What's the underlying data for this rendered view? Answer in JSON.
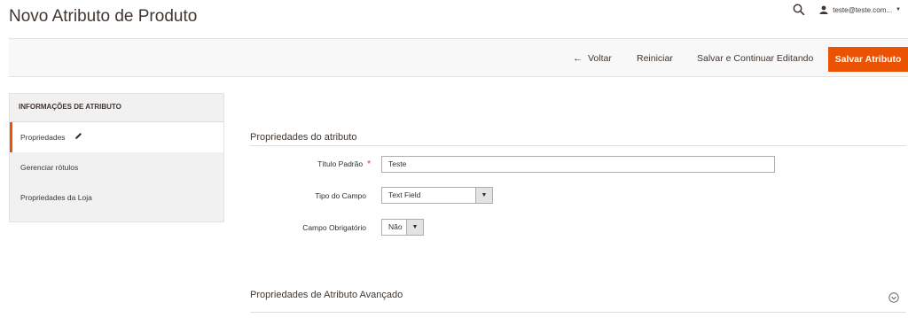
{
  "header": {
    "title": "Novo Atributo de Produto",
    "user": "teste@teste.com...",
    "search_icon": "search-icon",
    "user_icon": "user-icon"
  },
  "actions": {
    "back": "Voltar",
    "reset": "Reiniciar",
    "save_continue": "Salvar e Continuar Editando",
    "save": "Salvar Atributo",
    "accent": "#eb5202"
  },
  "sidebar": {
    "heading": "INFORMAÇÕES DE ATRIBUTO",
    "items": [
      {
        "label": "Propriedades",
        "active": true
      },
      {
        "label": "Gerenciar rótulos",
        "active": false
      },
      {
        "label": "Propriedades da Loja",
        "active": false
      }
    ]
  },
  "main": {
    "section_title": "Propriedades do atributo",
    "fields": {
      "default_label": {
        "label": "Título Padrão",
        "required_mark": "*",
        "value": "Teste"
      },
      "input_type": {
        "label": "Tipo do Campo",
        "value": "Text Field"
      },
      "required": {
        "label": "Campo Obrigatório",
        "value": "Não"
      }
    },
    "advanced_title": "Propriedades de Atributo Avançado"
  }
}
